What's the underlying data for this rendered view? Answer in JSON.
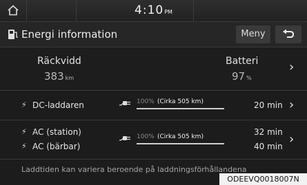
{
  "statusbar": {
    "time": "4:10",
    "time_suffix": "PM"
  },
  "titlebar": {
    "title": "Energi information",
    "menu_label": "Meny"
  },
  "range": {
    "label": "Räckvidd",
    "value": "383",
    "unit": "km"
  },
  "battery": {
    "label": "Batteri",
    "value": "97",
    "unit": "%"
  },
  "charging": {
    "dc": {
      "label": "DC-laddaren",
      "percent": "100%",
      "approx": "(Cirka 505 km)",
      "minutes": "20 min"
    },
    "ac": {
      "label_station": "AC (station)",
      "label_portable": "AC (bärbar)",
      "percent": "100%",
      "approx": "(Cirka 505 km)",
      "minutes_station": "32 min",
      "minutes_portable": "40 min"
    }
  },
  "note": "Laddtiden kan variera beroende på laddningsförhållandena",
  "figure_code": "ODEEVQ0018007N"
}
